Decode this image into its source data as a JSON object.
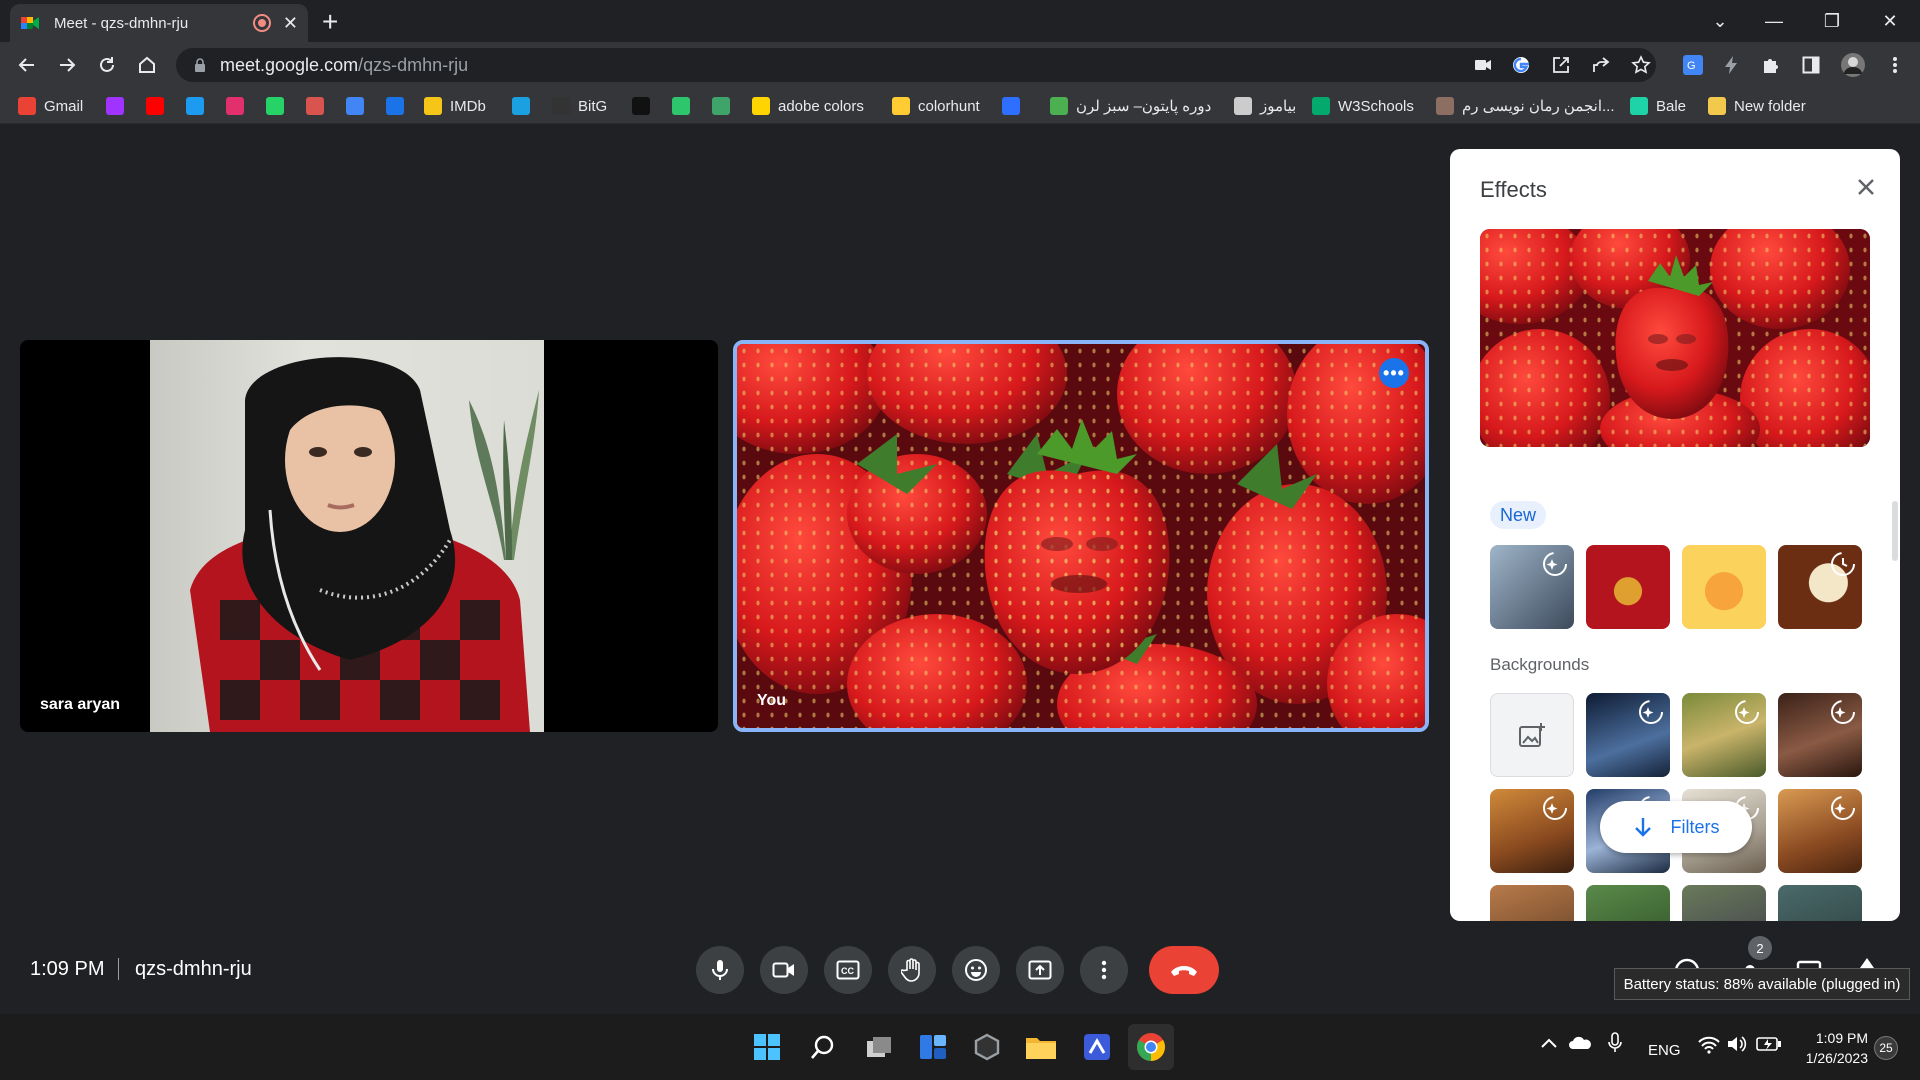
{
  "browser": {
    "tab_title": "Meet - qzs-dmhn-rju",
    "url_host": "meet.google.com",
    "url_path": "/qzs-dmhn-rju"
  },
  "bookmarks": [
    {
      "label": "Gmail",
      "icon": "gmail-icon",
      "color": "#ea4335"
    },
    {
      "label": "",
      "icon": "messenger-icon",
      "color": "#a033ff"
    },
    {
      "label": "",
      "icon": "youtube-icon",
      "color": "#ff0000"
    },
    {
      "label": "",
      "icon": "twitter-icon",
      "color": "#1d9bf0"
    },
    {
      "label": "",
      "icon": "instagram-icon",
      "color": "#e1306c"
    },
    {
      "label": "",
      "icon": "whatsapp-icon",
      "color": "#25d366"
    },
    {
      "label": "",
      "icon": "bookmark-icon",
      "color": "#d9534f"
    },
    {
      "label": "",
      "icon": "translate-icon",
      "color": "#4285f4"
    },
    {
      "label": "",
      "icon": "maps-icon",
      "color": "#1a73e8"
    },
    {
      "label": "IMDb",
      "icon": "imdb-icon",
      "color": "#f5c518"
    },
    {
      "label": "",
      "icon": "jupyter-icon",
      "color": "#1ba1e2"
    },
    {
      "label": "BitG",
      "icon": "bitg-icon",
      "color": "#333333"
    },
    {
      "label": "",
      "icon": "unsplash-icon",
      "color": "#111111"
    },
    {
      "label": "",
      "icon": "pixabay-icon",
      "color": "#2ec66d"
    },
    {
      "label": "",
      "icon": "d-icon",
      "color": "#3fa46a"
    },
    {
      "label": "adobe colors",
      "icon": "adobe-color-icon",
      "color": "#ffd400"
    },
    {
      "label": "colorhunt",
      "icon": "colorhunt-icon",
      "color": "#ffcc33"
    },
    {
      "label": "",
      "icon": "c-icon",
      "color": "#2f6fff"
    },
    {
      "label": "دوره پایتون– سبز لرن",
      "icon": "leaf-icon",
      "color": "#4caf50"
    },
    {
      "label": "بیاموز",
      "icon": "biamooz-icon",
      "color": "#cccccc"
    },
    {
      "label": "W3Schools",
      "icon": "w3schools-icon",
      "color": "#04aa6d"
    },
    {
      "label": "انجمن رمان نویسی رم...",
      "icon": "forum-icon",
      "color": "#8d6e63"
    },
    {
      "label": "Bale",
      "icon": "bale-icon",
      "color": "#1dd3a7"
    },
    {
      "label": "New folder",
      "icon": "folder-icon",
      "color": "#f2c94c"
    }
  ],
  "meet": {
    "participant_name": "sara aryan",
    "self_name": "You",
    "time": "1:09 PM",
    "meeting_code": "qzs-dmhn-rju"
  },
  "controls": [
    "microphone-icon",
    "camera-icon",
    "captions-icon",
    "raise-hand-icon",
    "emoji-icon",
    "present-icon",
    "more-options-icon",
    "end-call-icon"
  ],
  "effects_panel": {
    "title": "Effects",
    "new_label": "New",
    "backgrounds_label": "Backgrounds",
    "filters_label": "Filters"
  },
  "tray": {
    "badge_count": "2",
    "battery_tooltip": "Battery status: 88% available (plugged in)",
    "language": "ENG",
    "clock_time": "1:09 PM",
    "clock_date": "1/26/2023",
    "notification_count": "25"
  }
}
